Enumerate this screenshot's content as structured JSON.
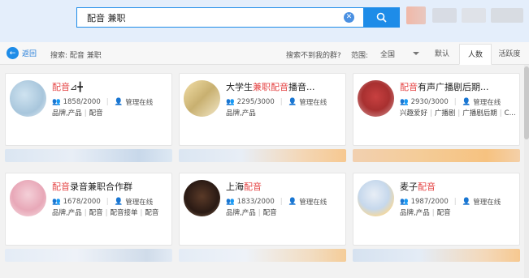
{
  "search": {
    "query": "配音 兼职",
    "clear_icon": "clear-icon",
    "search_icon": "search-icon"
  },
  "toolbar": {
    "back_label": "返回",
    "search_info": "搜索: 配音 兼职",
    "not_found_text": "搜索不到我的群?",
    "range_label": "范围:",
    "range_value": "全国",
    "sort_tabs": [
      "默认",
      "人数",
      "活跃度"
    ],
    "active_sort": "人数"
  },
  "groups": [
    {
      "name_hl": "配音",
      "name_rest": "⊿╋",
      "members": "1858/2000",
      "admin": "管理在线",
      "tags": [
        "品牌,产品",
        "配音"
      ]
    },
    {
      "name_prefix": "大学生",
      "name_hl": "兼职配音",
      "name_rest": "播音...",
      "members": "2295/3000",
      "admin": "管理在线",
      "tags": [
        "品牌,产品"
      ]
    },
    {
      "name_hl": "配音",
      "name_rest": "有声广播剧后期...",
      "members": "2930/3000",
      "admin": "管理在线",
      "tags": [
        "兴趣爱好",
        "广播剧",
        "广播剧后期",
        "C..."
      ]
    },
    {
      "name_hl": "配音",
      "name_rest": "录音兼职合作群",
      "members": "1678/2000",
      "admin": "管理在线",
      "tags": [
        "品牌,产品",
        "配音",
        "配音接单",
        "配音"
      ]
    },
    {
      "name_prefix": "上海",
      "name_hl": "配音",
      "name_rest": "",
      "members": "1833/2000",
      "admin": "管理在线",
      "tags": [
        "品牌,产品",
        "配音"
      ]
    },
    {
      "name_prefix": "麦子",
      "name_hl": "配音",
      "name_rest": "",
      "members": "1987/2000",
      "admin": "管理在线",
      "tags": [
        "品牌,产品",
        "配音"
      ]
    }
  ],
  "colors": {
    "accent": "#1e8ce8",
    "highlight": "#e54545"
  }
}
